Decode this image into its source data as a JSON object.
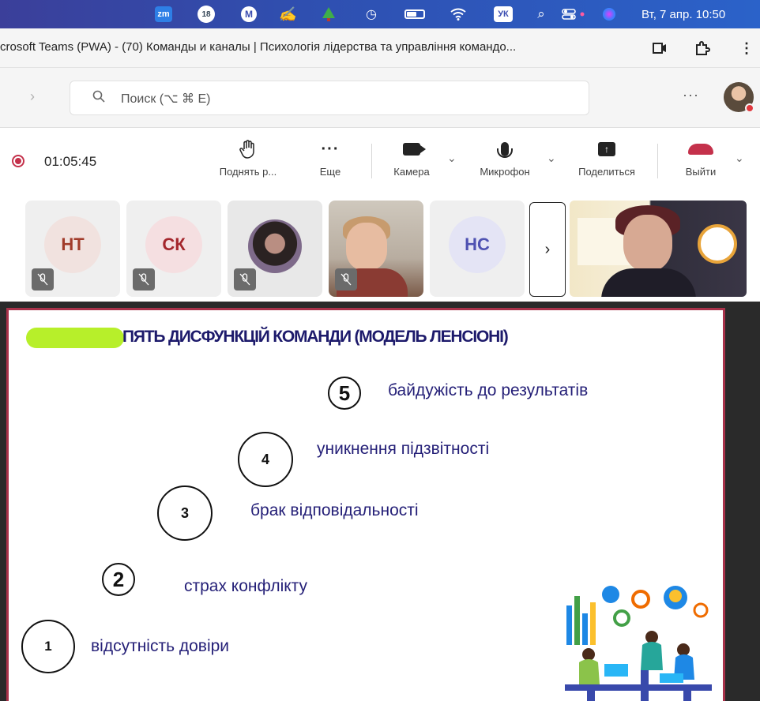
{
  "menubar": {
    "zoom_label": "zm",
    "badge_count": "18",
    "mail_letter": "M",
    "keyboard_lang": "УК",
    "datetime": "Вт, 7 апр.  10:50"
  },
  "window": {
    "title": "crosoft Teams (PWA) - (70) Команды и каналы | Психологія лідерства та управління командо..."
  },
  "search": {
    "placeholder": "Поиск (⌥ ⌘ E)"
  },
  "meeting": {
    "timer": "01:05:45",
    "raise_hand_label": "Поднять р...",
    "more_label": "Еще",
    "camera_label": "Камера",
    "mic_label": "Микрофон",
    "share_label": "Поделиться",
    "leave_label": "Выйти"
  },
  "participants": [
    {
      "initials": "НТ"
    },
    {
      "initials": "СК"
    },
    {
      "initials": ""
    },
    {
      "initials": ""
    },
    {
      "initials": "НС"
    }
  ],
  "slide": {
    "title": "ПЯТЬ ДИСФУНКЦІЙ КОМАНДИ (МОДЕЛЬ ЛЕНСІОНІ)",
    "steps": [
      {
        "num": "5",
        "text": "байдужість до результатів"
      },
      {
        "num": "4",
        "text": "уникнення підзвітності"
      },
      {
        "num": "3",
        "text": "брак відповідальності"
      },
      {
        "num": "2",
        "text": "страх конфлікту"
      },
      {
        "num": "1",
        "text": "відсутність довіри"
      }
    ],
    "highlight_color": "#b7ef2a",
    "title_color": "#1d1a6b",
    "border_color": "#a8324a"
  },
  "colors": {
    "record": "#c4314b",
    "leave": "#c4314b"
  }
}
